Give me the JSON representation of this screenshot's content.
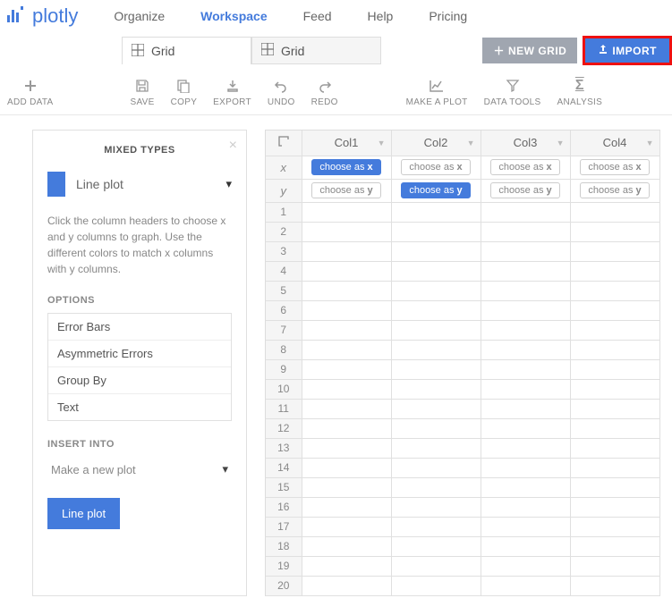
{
  "brand": "plotly",
  "nav": {
    "items": [
      "Organize",
      "Workspace",
      "Feed",
      "Help",
      "Pricing"
    ],
    "active_index": 1
  },
  "tabs": [
    {
      "label": "Grid",
      "active": true
    },
    {
      "label": "Grid",
      "active": false
    }
  ],
  "buttons": {
    "new_grid": "NEW GRID",
    "import": "IMPORT"
  },
  "toolbar": [
    {
      "id": "add-data",
      "label": "ADD DATA",
      "icon": "plus"
    },
    {
      "id": "save",
      "label": "SAVE",
      "icon": "save"
    },
    {
      "id": "copy",
      "label": "COPY",
      "icon": "copy"
    },
    {
      "id": "export",
      "label": "EXPORT",
      "icon": "export"
    },
    {
      "id": "undo",
      "label": "UNDO",
      "icon": "undo"
    },
    {
      "id": "redo",
      "label": "REDO",
      "icon": "redo"
    },
    {
      "id": "make-a-plot",
      "label": "MAKE A PLOT",
      "icon": "plot"
    },
    {
      "id": "data-tools",
      "label": "DATA TOOLS",
      "icon": "funnel"
    },
    {
      "id": "analysis",
      "label": "ANALYSIS",
      "icon": "sigma"
    }
  ],
  "panel": {
    "title": "MIXED TYPES",
    "plot_type": "Line plot",
    "help": "Click the column headers to choose x and y columns to graph. Use the different colors to match x columns with y columns.",
    "options_label": "OPTIONS",
    "options": [
      "Error Bars",
      "Asymmetric Errors",
      "Group By",
      "Text"
    ],
    "insert_label": "INSERT INTO",
    "insert_value": "Make a new plot",
    "go_label": "Line plot"
  },
  "grid": {
    "columns": [
      "Col1",
      "Col2",
      "Col3",
      "Col4"
    ],
    "axis_rows": [
      "x",
      "y"
    ],
    "choose_x_label": "choose as",
    "choose_y_label": "choose as",
    "x_active_col": 0,
    "y_active_col": 1,
    "row_count": 20
  }
}
